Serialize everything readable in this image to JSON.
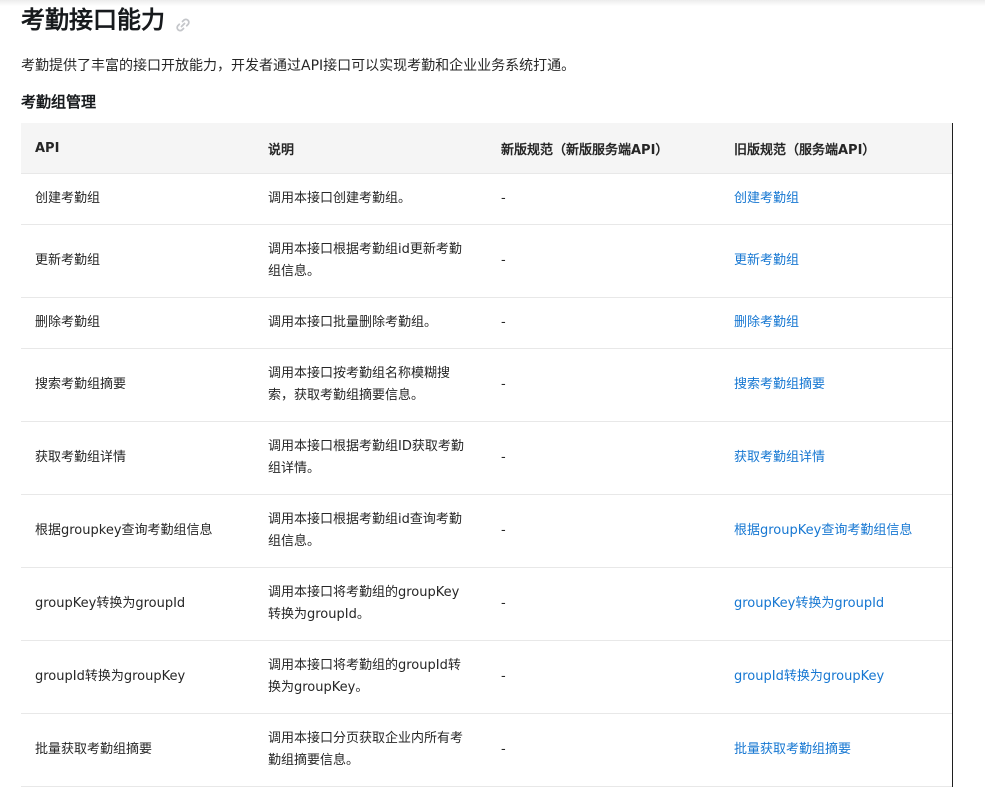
{
  "page": {
    "title": "考勤接口能力",
    "intro": "考勤提供了丰富的接口开放能力，开发者通过API接口可以实现考勤和企业业务系统打通。",
    "section_title": "考勤组管理"
  },
  "table": {
    "headers": [
      "API",
      "说明",
      "新版规范（新版服务端API）",
      "旧版规范（服务端API）"
    ],
    "rows": [
      {
        "api": "创建考勤组",
        "desc": "调用本接口创建考勤组。",
        "new": "-",
        "old": "创建考勤组"
      },
      {
        "api": "更新考勤组",
        "desc": "调用本接口根据考勤组id更新考勤组信息。",
        "new": "-",
        "old": "更新考勤组"
      },
      {
        "api": "删除考勤组",
        "desc": "调用本接口批量删除考勤组。",
        "new": "-",
        "old": "删除考勤组"
      },
      {
        "api": "搜索考勤组摘要",
        "desc": "调用本接口按考勤组名称模糊搜索，获取考勤组摘要信息。",
        "new": "-",
        "old": "搜索考勤组摘要"
      },
      {
        "api": "获取考勤组详情",
        "desc": "调用本接口根据考勤组ID获取考勤组详情。",
        "new": "-",
        "old": "获取考勤组详情"
      },
      {
        "api": "根据groupkey查询考勤组信息",
        "desc": "调用本接口根据考勤组id查询考勤组信息。",
        "new": "-",
        "old": "根据groupKey查询考勤组信息"
      },
      {
        "api": "groupKey转换为groupId",
        "desc": "调用本接口将考勤组的groupKey转换为groupId。",
        "new": "-",
        "old": "groupKey转换为groupId"
      },
      {
        "api": "groupId转换为groupKey",
        "desc": "调用本接口将考勤组的groupId转换为groupKey。",
        "new": "-",
        "old": "groupId转换为groupKey"
      },
      {
        "api": "批量获取考勤组摘要",
        "desc": "调用本接口分页获取企业内所有考勤组摘要信息。",
        "new": "-",
        "old": "批量获取考勤组摘要"
      }
    ]
  },
  "colors": {
    "link": "#1677d2",
    "header_bg": "#f5f5f5"
  },
  "icons": {
    "anchor": "link-icon"
  }
}
